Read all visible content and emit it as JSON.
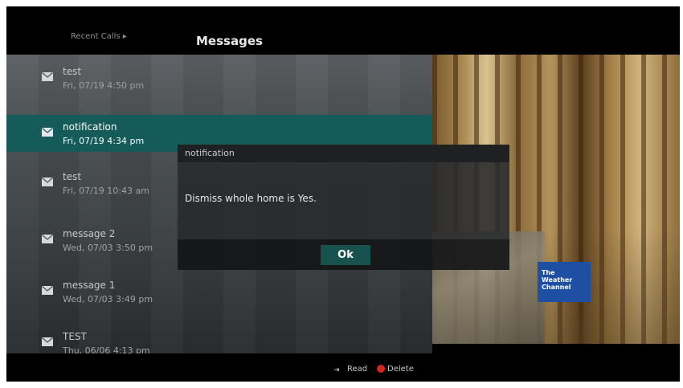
{
  "header": {
    "recent_calls_tab": "Recent Calls ▸",
    "messages_tab": "Messages"
  },
  "messages": [
    {
      "subject": "test",
      "date": "Fri, 07/19 4:50 pm",
      "icon": "envelope-icon"
    },
    {
      "subject": "notification",
      "date": "Fri, 07/19 4:34 pm",
      "icon": "envelope-icon",
      "selected": true
    },
    {
      "subject": "test",
      "date": "Fri, 07/19 10:43 am",
      "icon": "envelope-icon"
    },
    {
      "subject": "message 2",
      "date": "Wed, 07/03 3:50 pm",
      "icon": "envelope-icon"
    },
    {
      "subject": "message 1",
      "date": "Wed, 07/03 3:49 pm",
      "icon": "envelope-icon"
    },
    {
      "subject": "TEST",
      "date": "Thu, 06/06 4:13 pm",
      "icon": "envelope-icon"
    }
  ],
  "dialog": {
    "title": "notification",
    "message": "Dismiss whole home is Yes.",
    "ok_label": "Ok"
  },
  "video": {
    "channel_logo_line1": "The",
    "channel_logo_line2": "Weather",
    "channel_logo_line3": "Channel"
  },
  "footer": {
    "read_arrow": "⇥",
    "read_label": "Read",
    "delete_label": "Delete",
    "delete_color": "#d2261f"
  },
  "colors": {
    "selected_row": "#145b5a",
    "ok_button": "#17524f",
    "channel_logo": "#1d4fa3"
  }
}
